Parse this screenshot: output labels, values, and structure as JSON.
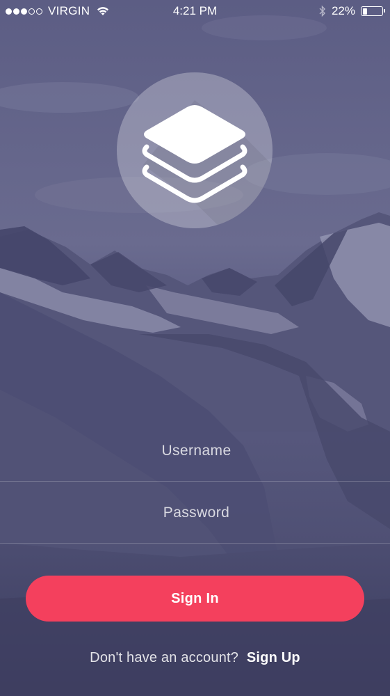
{
  "status_bar": {
    "signal_dots": [
      true,
      true,
      true,
      false,
      false
    ],
    "carrier": "VIRGIN",
    "time": "4:21 PM",
    "battery_percent": "22%",
    "battery_level": 0.22
  },
  "logo": {
    "icon": "layers-icon"
  },
  "login_form": {
    "username_placeholder": "Username",
    "username_value": "",
    "password_placeholder": "Password",
    "password_value": ""
  },
  "signin_button_label": "Sign In",
  "signup_prompt": {
    "text": "Don't have an account?",
    "link_label": "Sign Up"
  },
  "colors": {
    "overlay": "#54557a",
    "accent": "#f4405d",
    "text": "#ffffff"
  }
}
